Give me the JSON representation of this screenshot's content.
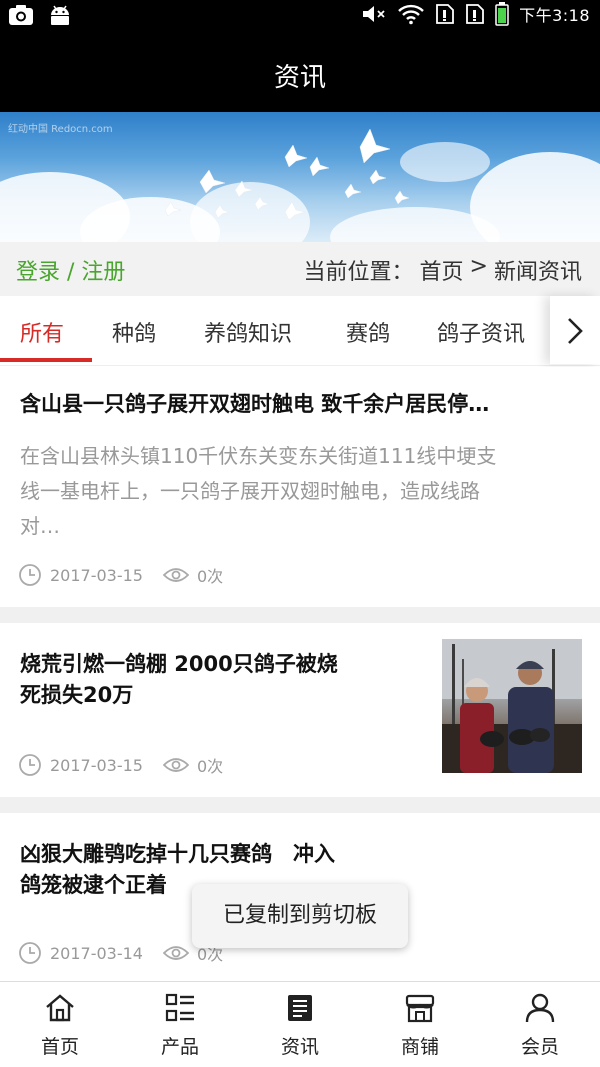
{
  "status_bar": {
    "time": "下午3:18",
    "left_icons": [
      "camera-icon",
      "android-icon"
    ],
    "right_icons": [
      "mute-icon",
      "wifi-icon",
      "sim-icon",
      "sim-icon",
      "battery-icon"
    ]
  },
  "header": {
    "title": "资讯"
  },
  "banner": {
    "watermark": "红动中国 Redocn.com"
  },
  "crumb": {
    "login": "登录 / 注册",
    "location_label": "当前位置：",
    "home": "首页",
    "sep": ">",
    "current": "新闻资讯"
  },
  "tabs": {
    "items": [
      "所有",
      "种鸽",
      "养鸽知识",
      "赛鸽",
      "鸽子资讯"
    ],
    "active_index": 0
  },
  "articles": [
    {
      "title": "含山县一只鸽子展开双翅时触电 致千余户居民停…",
      "summary": [
        "在含山县林头镇110千伏东关变东关街道111线中埂支",
        "线一基电杆上，一只鸽子展开双翅时触电，造成线路",
        "对…"
      ],
      "date": "2017-03-15",
      "views": "0次"
    },
    {
      "title_lines": [
        "烧荒引燃一鸽棚 2000只鸽子被烧",
        "死损失20万"
      ],
      "date": "2017-03-15",
      "views": "0次"
    },
    {
      "title_lines": [
        "凶狠大雕鸮吃掉十几只赛鸽　冲入",
        "鸽笼被逮个正着"
      ],
      "date": "2017-03-14",
      "views": "0次"
    }
  ],
  "toast": "已复制到剪切板",
  "bottom_nav": [
    {
      "label": "首页",
      "icon": "home-icon"
    },
    {
      "label": "产品",
      "icon": "product-list-icon"
    },
    {
      "label": "资讯",
      "icon": "news-icon"
    },
    {
      "label": "商铺",
      "icon": "store-icon"
    },
    {
      "label": "会员",
      "icon": "member-icon"
    }
  ],
  "colors": {
    "accent_red": "#d62b26",
    "login_green": "#4aa52e",
    "header_bg": "#000000",
    "muted_text": "#999999"
  }
}
